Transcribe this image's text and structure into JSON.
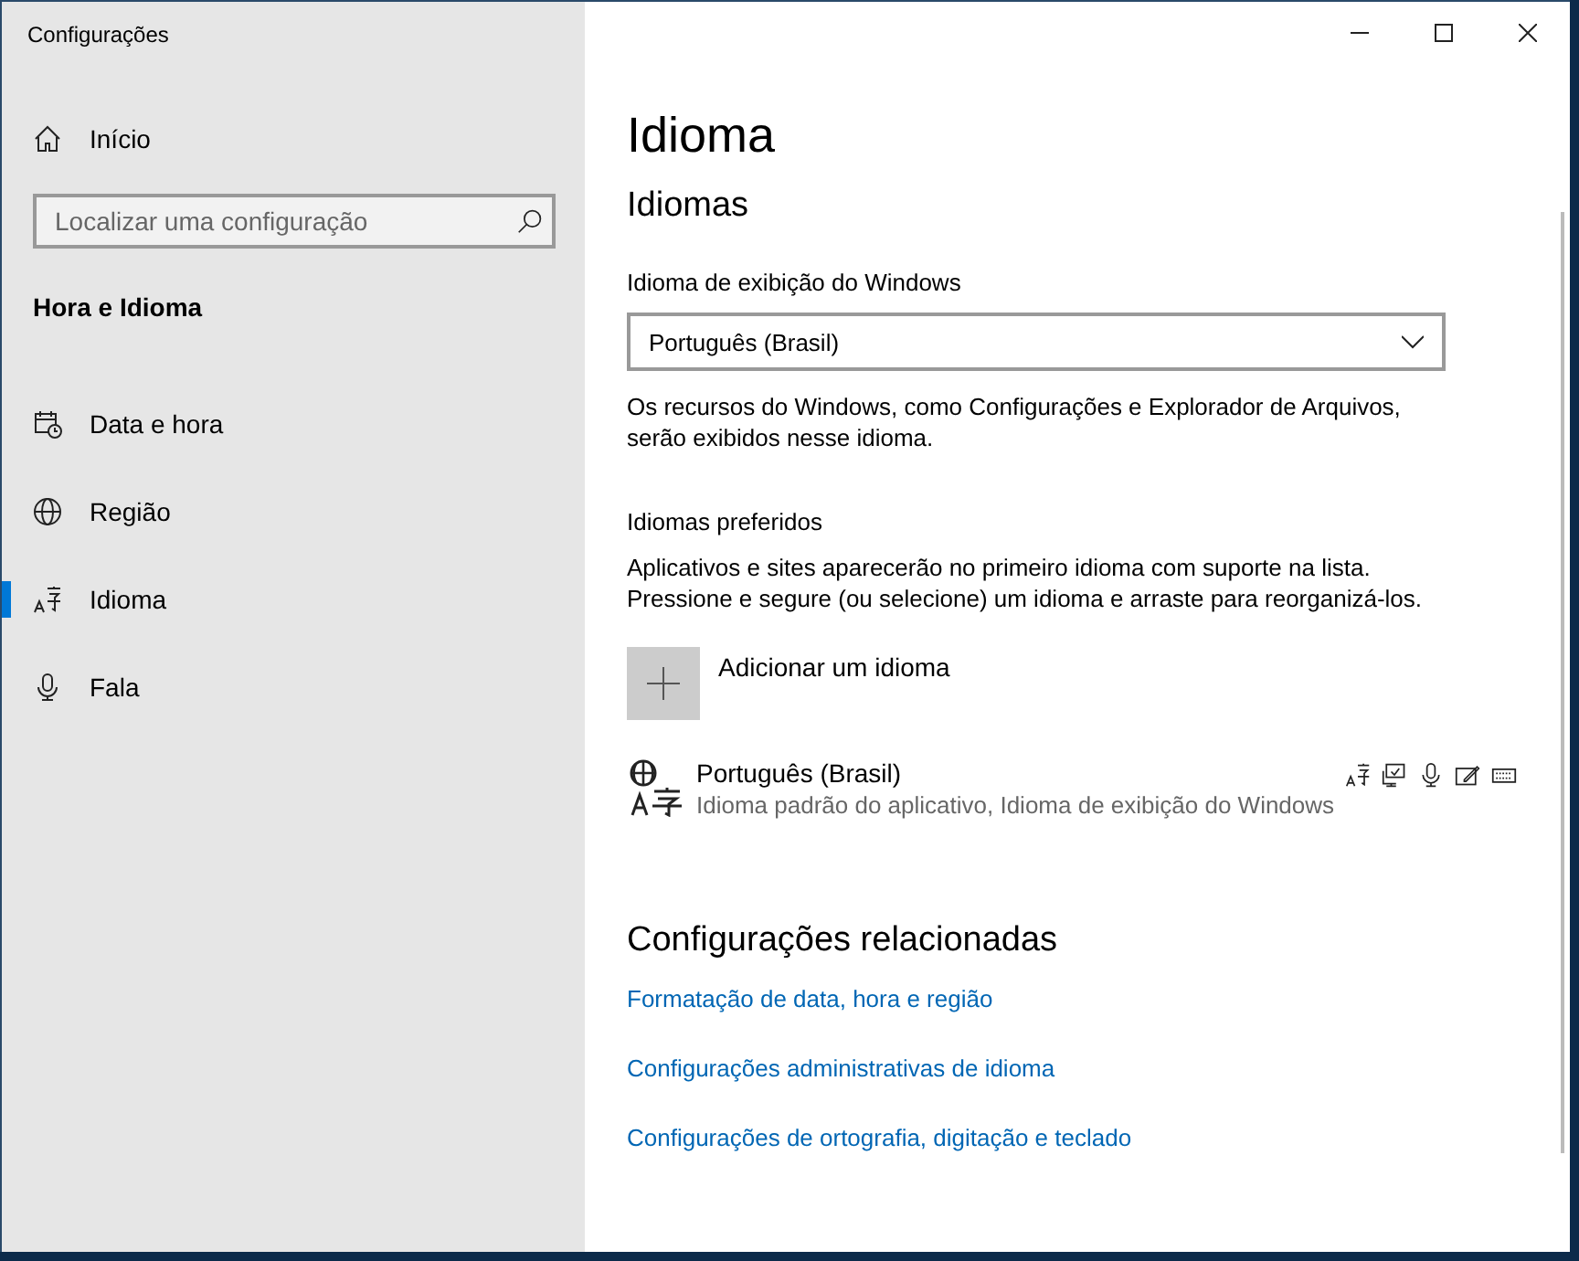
{
  "window": {
    "title": "Configurações"
  },
  "sidebar": {
    "home": {
      "label": "Início"
    },
    "search": {
      "placeholder": "Localizar uma configuração"
    },
    "section": "Hora e Idioma",
    "items": [
      {
        "label": "Data e hora",
        "kind": "calendar",
        "selected": false
      },
      {
        "label": "Região",
        "kind": "globe",
        "selected": false
      },
      {
        "label": "Idioma",
        "kind": "language",
        "selected": true
      },
      {
        "label": "Fala",
        "kind": "microphone",
        "selected": false
      }
    ]
  },
  "page": {
    "title": "Idioma",
    "section": "Idiomas",
    "display_label": "Idioma de exibição do Windows",
    "display_value": "Português (Brasil)",
    "display_note": "Os recursos do Windows, como Configurações e Explorador de Arquivos, serão exibidos nesse idioma.",
    "preferred_label": "Idiomas preferidos",
    "preferred_note": "Aplicativos e sites aparecerão no primeiro idioma com suporte na lista. Pressione e segure (ou selecione) um idioma e arraste para reorganizá-los.",
    "add_label": "Adicionar um idioma",
    "languages": [
      {
        "name": "Português (Brasil)",
        "detail": "Idioma padrão do aplicativo, Idioma de exibição do Windows"
      }
    ],
    "related_title": "Configurações relacionadas",
    "links": [
      "Formatação de data, hora e região",
      "Configurações administrativas de idioma",
      "Configurações de ortografia, digitação e teclado"
    ]
  }
}
